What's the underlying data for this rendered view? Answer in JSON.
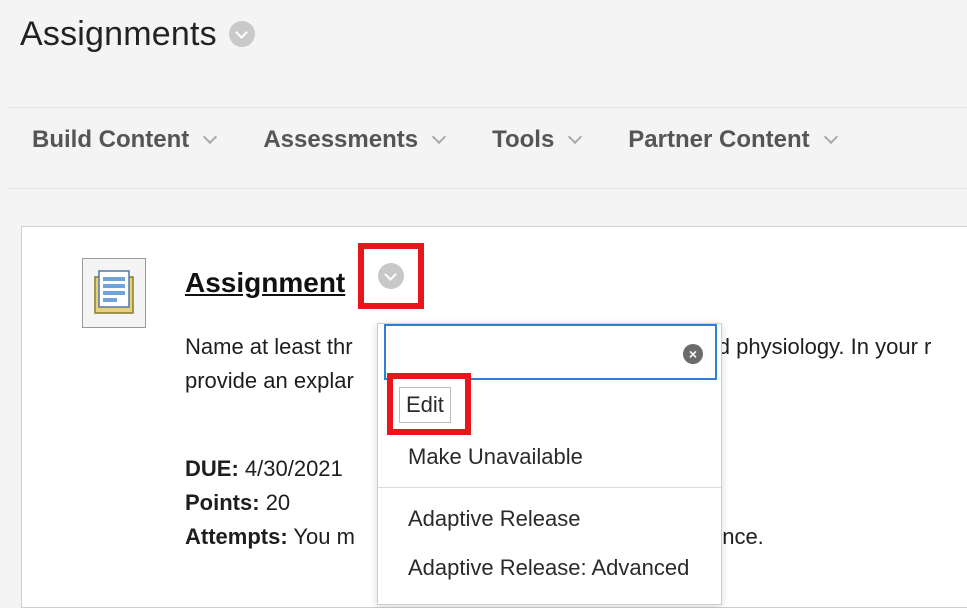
{
  "page": {
    "title": "Assignments"
  },
  "menubar": {
    "items": [
      {
        "label": "Build Content"
      },
      {
        "label": "Assessments"
      },
      {
        "label": "Tools"
      },
      {
        "label": "Partner Content"
      }
    ]
  },
  "item": {
    "title": "Assignment",
    "description_line1_left": "Name at least thr",
    "description_line1_right": "nd physiology. In your r",
    "description_line2_left": "provide an explar",
    "due_label": "DUE:",
    "due_value": "4/30/2021",
    "points_label": "Points:",
    "points_value": "20",
    "attempts_label": "Attempts:",
    "attempts_value_left": "You m",
    "attempts_value_right": "once."
  },
  "dropdown": {
    "search_value": "",
    "items": [
      {
        "label": "Edit"
      },
      {
        "label": "Make Unavailable"
      },
      {
        "label": "Adaptive Release"
      },
      {
        "label": "Adaptive Release: Advanced"
      }
    ]
  },
  "icons": {
    "title_menu": "chevron-down-circle-icon",
    "item_menu": "chevron-down-circle-icon",
    "clear": "clear-x-circle-icon",
    "item_type": "assignment-document-icon"
  },
  "colors": {
    "highlight": "#e8151b",
    "focus": "#2f7fd4"
  }
}
